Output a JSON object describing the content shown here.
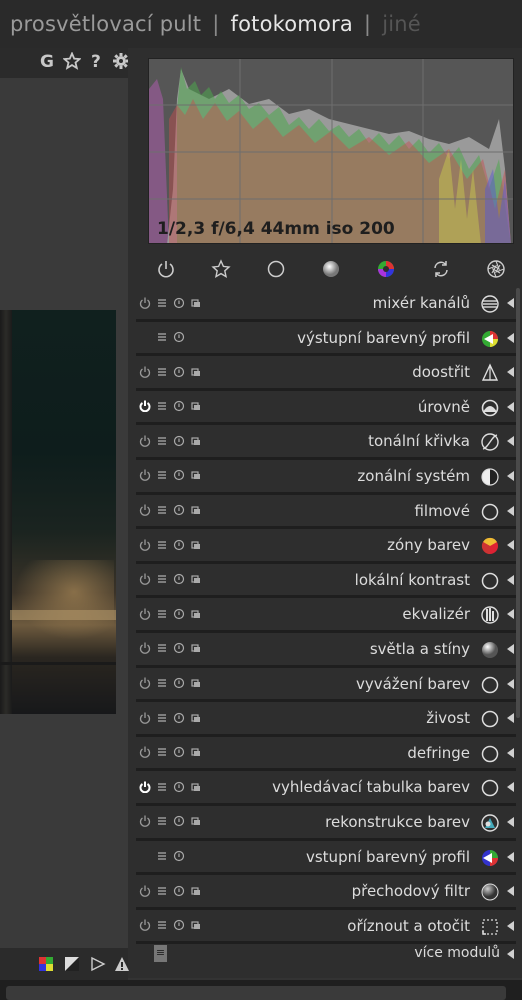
{
  "nav": {
    "view1": "prosvětlovací pult",
    "sep1": "|",
    "view2": "fotokomora",
    "sep2": "|",
    "view3": "jiné"
  },
  "left_toolbar": {
    "grouping_label": "G",
    "star_icon": "star-icon",
    "help_label": "?",
    "gear_icon": "gear-icon"
  },
  "histogram": {
    "exif": "1/2,3 f/6,4 44mm iso 200"
  },
  "module_groups": [
    "power-icon",
    "star-icon",
    "circle-icon",
    "sphere-icon",
    "color-wheel-icon",
    "refresh-icon",
    "aperture-icon"
  ],
  "modules": [
    {
      "label": "mixér kanálů",
      "icon": "mixer-icon",
      "power": true,
      "multi": true
    },
    {
      "label": "výstupní barevný profil",
      "icon": "output-profile-icon",
      "power": false,
      "multi": false
    },
    {
      "label": "doostřit",
      "icon": "sharpen-icon",
      "power": true,
      "multi": true
    },
    {
      "label": "úrovně",
      "icon": "levels-icon",
      "power": true,
      "multi": true,
      "active": true
    },
    {
      "label": "tonální křivka",
      "icon": "curve-icon",
      "power": true,
      "multi": true
    },
    {
      "label": "zonální systém",
      "icon": "zone-icon",
      "power": true,
      "multi": true
    },
    {
      "label": "filmové",
      "icon": "circle-icon",
      "power": true,
      "multi": true
    },
    {
      "label": "zóny barev",
      "icon": "color-zones-icon",
      "power": true,
      "multi": true
    },
    {
      "label": "lokální kontrast",
      "icon": "circle-icon",
      "power": true,
      "multi": true
    },
    {
      "label": "ekvalizér",
      "icon": "equalizer-icon",
      "power": true,
      "multi": true
    },
    {
      "label": "světla a stíny",
      "icon": "sphere-icon",
      "power": true,
      "multi": true
    },
    {
      "label": "vyvážení barev",
      "icon": "circle-icon",
      "power": true,
      "multi": true
    },
    {
      "label": "živost",
      "icon": "circle-icon",
      "power": true,
      "multi": true
    },
    {
      "label": "defringe",
      "icon": "circle-icon",
      "power": true,
      "multi": true
    },
    {
      "label": "vyhledávací tabulka barev",
      "icon": "circle-icon",
      "power": true,
      "multi": true,
      "active": true
    },
    {
      "label": "rekonstrukce barev",
      "icon": "reconstruct-icon",
      "power": true,
      "multi": true
    },
    {
      "label": "vstupní barevný profil",
      "icon": "input-profile-icon",
      "power": false,
      "multi": false
    },
    {
      "label": "přechodový filtr",
      "icon": "sphere-dark-icon",
      "power": true,
      "multi": true
    },
    {
      "label": "oříznout a otočit",
      "icon": "crop-icon",
      "power": true,
      "multi": true
    }
  ],
  "more_modules": {
    "label": "více modulů",
    "hamburger": "≡"
  },
  "bottom_icons": [
    "color-swatch-icon",
    "overexposure-icon",
    "softproof-icon",
    "gamut-warning-icon"
  ]
}
